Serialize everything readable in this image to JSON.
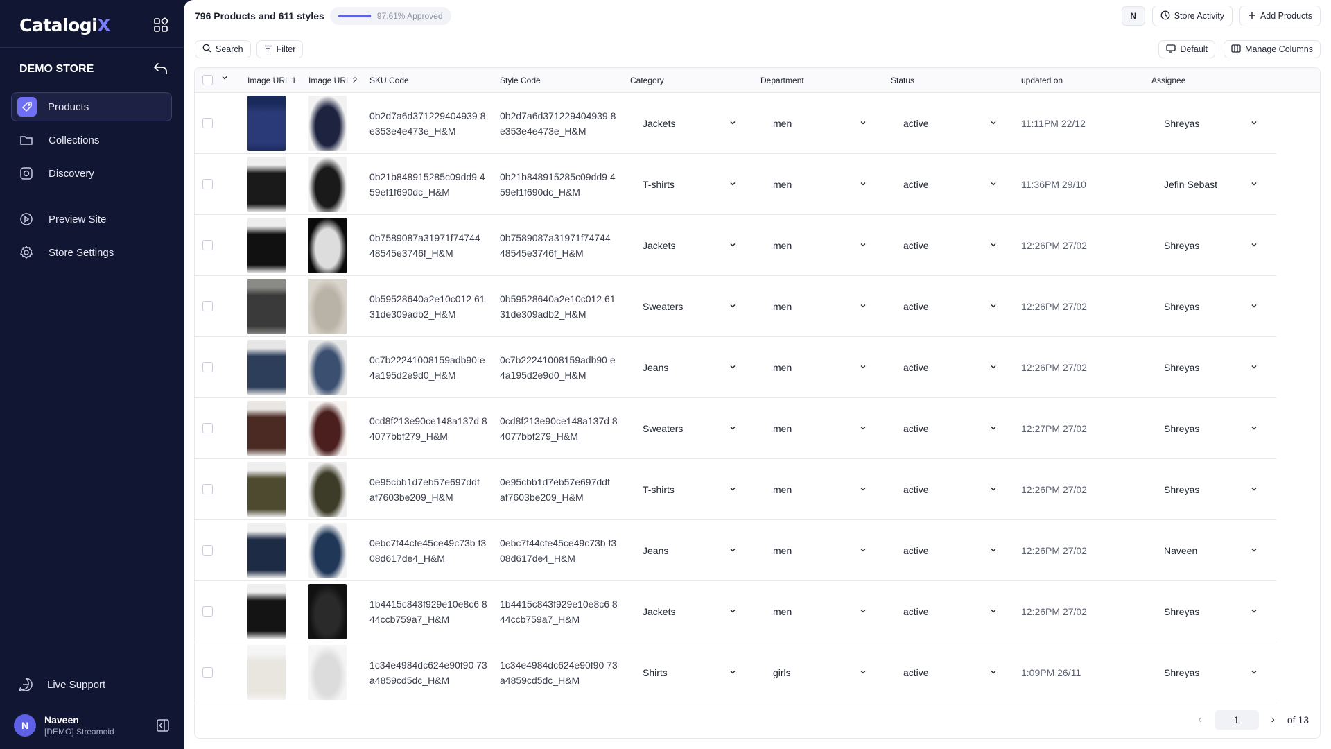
{
  "sidebar": {
    "logo_main": "Catalogi",
    "logo_x": "X",
    "store_name": "DEMO STORE",
    "nav": [
      {
        "label": "Products",
        "icon": "tag-icon",
        "active": true
      },
      {
        "label": "Collections",
        "icon": "folder-icon"
      },
      {
        "label": "Discovery",
        "icon": "discovery-icon"
      },
      {
        "label": "Preview Site",
        "icon": "play-circle-icon"
      },
      {
        "label": "Store Settings",
        "icon": "gear-icon"
      }
    ],
    "live_support": "Live Support",
    "user": {
      "initial": "N",
      "name": "Naveen",
      "org": "[DEMO] Streamoid"
    }
  },
  "header": {
    "summary": "796 Products and 611 styles",
    "approval_text": "97.61% Approved",
    "approval_fraction": 0.9761,
    "user_badge": "N",
    "store_activity": "Store Activity",
    "add_products": "Add Products"
  },
  "toolbar": {
    "search": "Search",
    "filter": "Filter",
    "default_view": "Default",
    "manage_columns": "Manage Columns"
  },
  "table": {
    "columns": [
      "Image URL 1",
      "Image URL 2",
      "SKU Code",
      "Style Code",
      "Category",
      "Department",
      "Status",
      "updated on",
      "Assignee"
    ],
    "rows": [
      {
        "sku": "0b2d7a6d371229404939 8e353e4e473e_H&M",
        "style": "0b2d7a6d371229404939 8e353e4e473e_H&M",
        "category": "Jackets",
        "department": "men",
        "status": "active",
        "updated": "11:11PM 22/12",
        "assignee": "Shreyas"
      },
      {
        "sku": "0b21b848915285c09dd9 459ef1f690dc_H&M",
        "style": "0b21b848915285c09dd9 459ef1f690dc_H&M",
        "category": "T-shirts",
        "department": "men",
        "status": "active",
        "updated": "11:36PM 29/10",
        "assignee": "Jefin Sebast"
      },
      {
        "sku": "0b7589087a31971f74744 48545e3746f_H&M",
        "style": "0b7589087a31971f74744 48545e3746f_H&M",
        "category": "Jackets",
        "department": "men",
        "status": "active",
        "updated": "12:26PM 27/02",
        "assignee": "Shreyas"
      },
      {
        "sku": "0b59528640a2e10c012 6131de309adb2_H&M",
        "style": "0b59528640a2e10c012 6131de309adb2_H&M",
        "category": "Sweaters",
        "department": "men",
        "status": "active",
        "updated": "12:26PM 27/02",
        "assignee": "Shreyas"
      },
      {
        "sku": "0c7b22241008159adb90 e4a195d2e9d0_H&M",
        "style": "0c7b22241008159adb90 e4a195d2e9d0_H&M",
        "category": "Jeans",
        "department": "men",
        "status": "active",
        "updated": "12:26PM 27/02",
        "assignee": "Shreyas"
      },
      {
        "sku": "0cd8f213e90ce148a137d 84077bbf279_H&M",
        "style": "0cd8f213e90ce148a137d 84077bbf279_H&M",
        "category": "Sweaters",
        "department": "men",
        "status": "active",
        "updated": "12:27PM 27/02",
        "assignee": "Shreyas"
      },
      {
        "sku": "0e95cbb1d7eb57e697ddf af7603be209_H&M",
        "style": "0e95cbb1d7eb57e697ddf af7603be209_H&M",
        "category": "T-shirts",
        "department": "men",
        "status": "active",
        "updated": "12:26PM 27/02",
        "assignee": "Shreyas"
      },
      {
        "sku": "0ebc7f44cfe45ce49c73b f308d617de4_H&M",
        "style": "0ebc7f44cfe45ce49c73b f308d617de4_H&M",
        "category": "Jeans",
        "department": "men",
        "status": "active",
        "updated": "12:26PM 27/02",
        "assignee": "Naveen"
      },
      {
        "sku": "1b4415c843f929e10e8c6 844ccb759a7_H&M",
        "style": "1b4415c843f929e10e8c6 844ccb759a7_H&M",
        "category": "Jackets",
        "department": "men",
        "status": "active",
        "updated": "12:26PM 27/02",
        "assignee": "Shreyas"
      },
      {
        "sku": "1c34e4984dc624e90f90 73a4859cd5dc_H&M",
        "style": "1c34e4984dc624e90f90 73a4859cd5dc_H&M",
        "category": "Shirts",
        "department": "girls",
        "status": "active",
        "updated": "1:09PM 26/11",
        "assignee": "Shreyas"
      }
    ]
  },
  "pagination": {
    "current": "1",
    "total_label": "of 13"
  }
}
